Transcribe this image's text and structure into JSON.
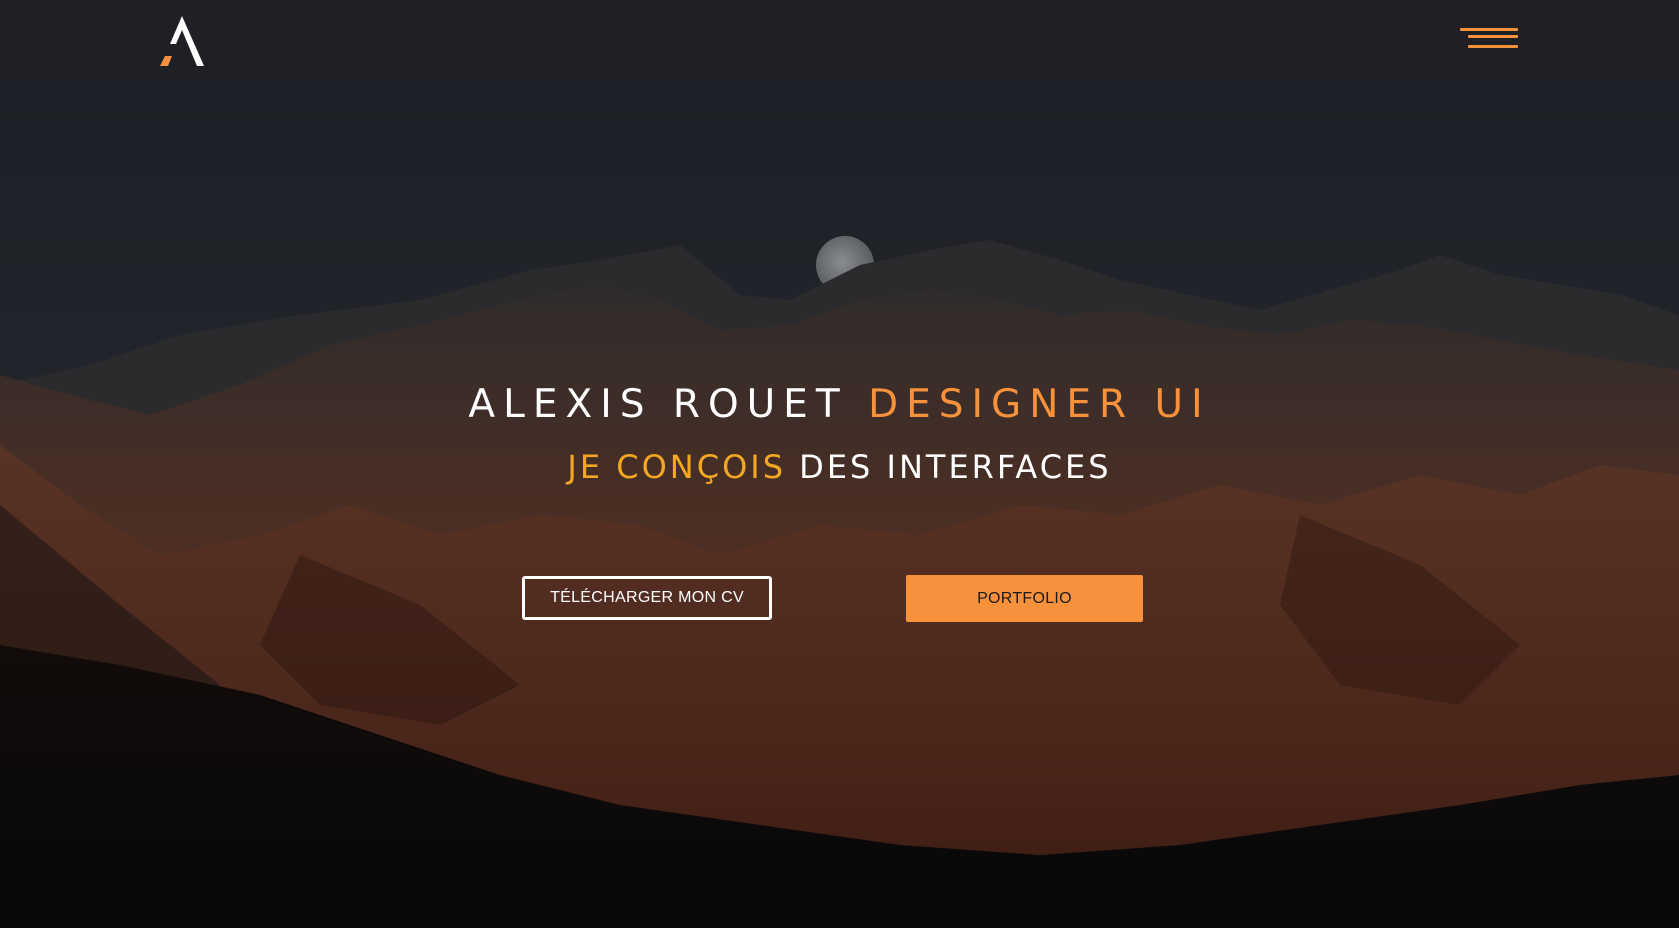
{
  "header": {
    "logo_label": "A",
    "menu_icon": "hamburger-menu-icon"
  },
  "hero": {
    "title_name": "ALEXIS ROUET",
    "title_role": "DESIGNER UI",
    "subtitle_accent": "JE CONÇOIS",
    "subtitle_rest": "DES INTERFACES",
    "cv_button": "TÉLÉCHARGER MON CV",
    "portfolio_button": "PORTFOLIO"
  },
  "colors": {
    "accent_orange": "#f7913b",
    "accent_yellow": "#f5a623",
    "header_bg": "#1f2026"
  }
}
